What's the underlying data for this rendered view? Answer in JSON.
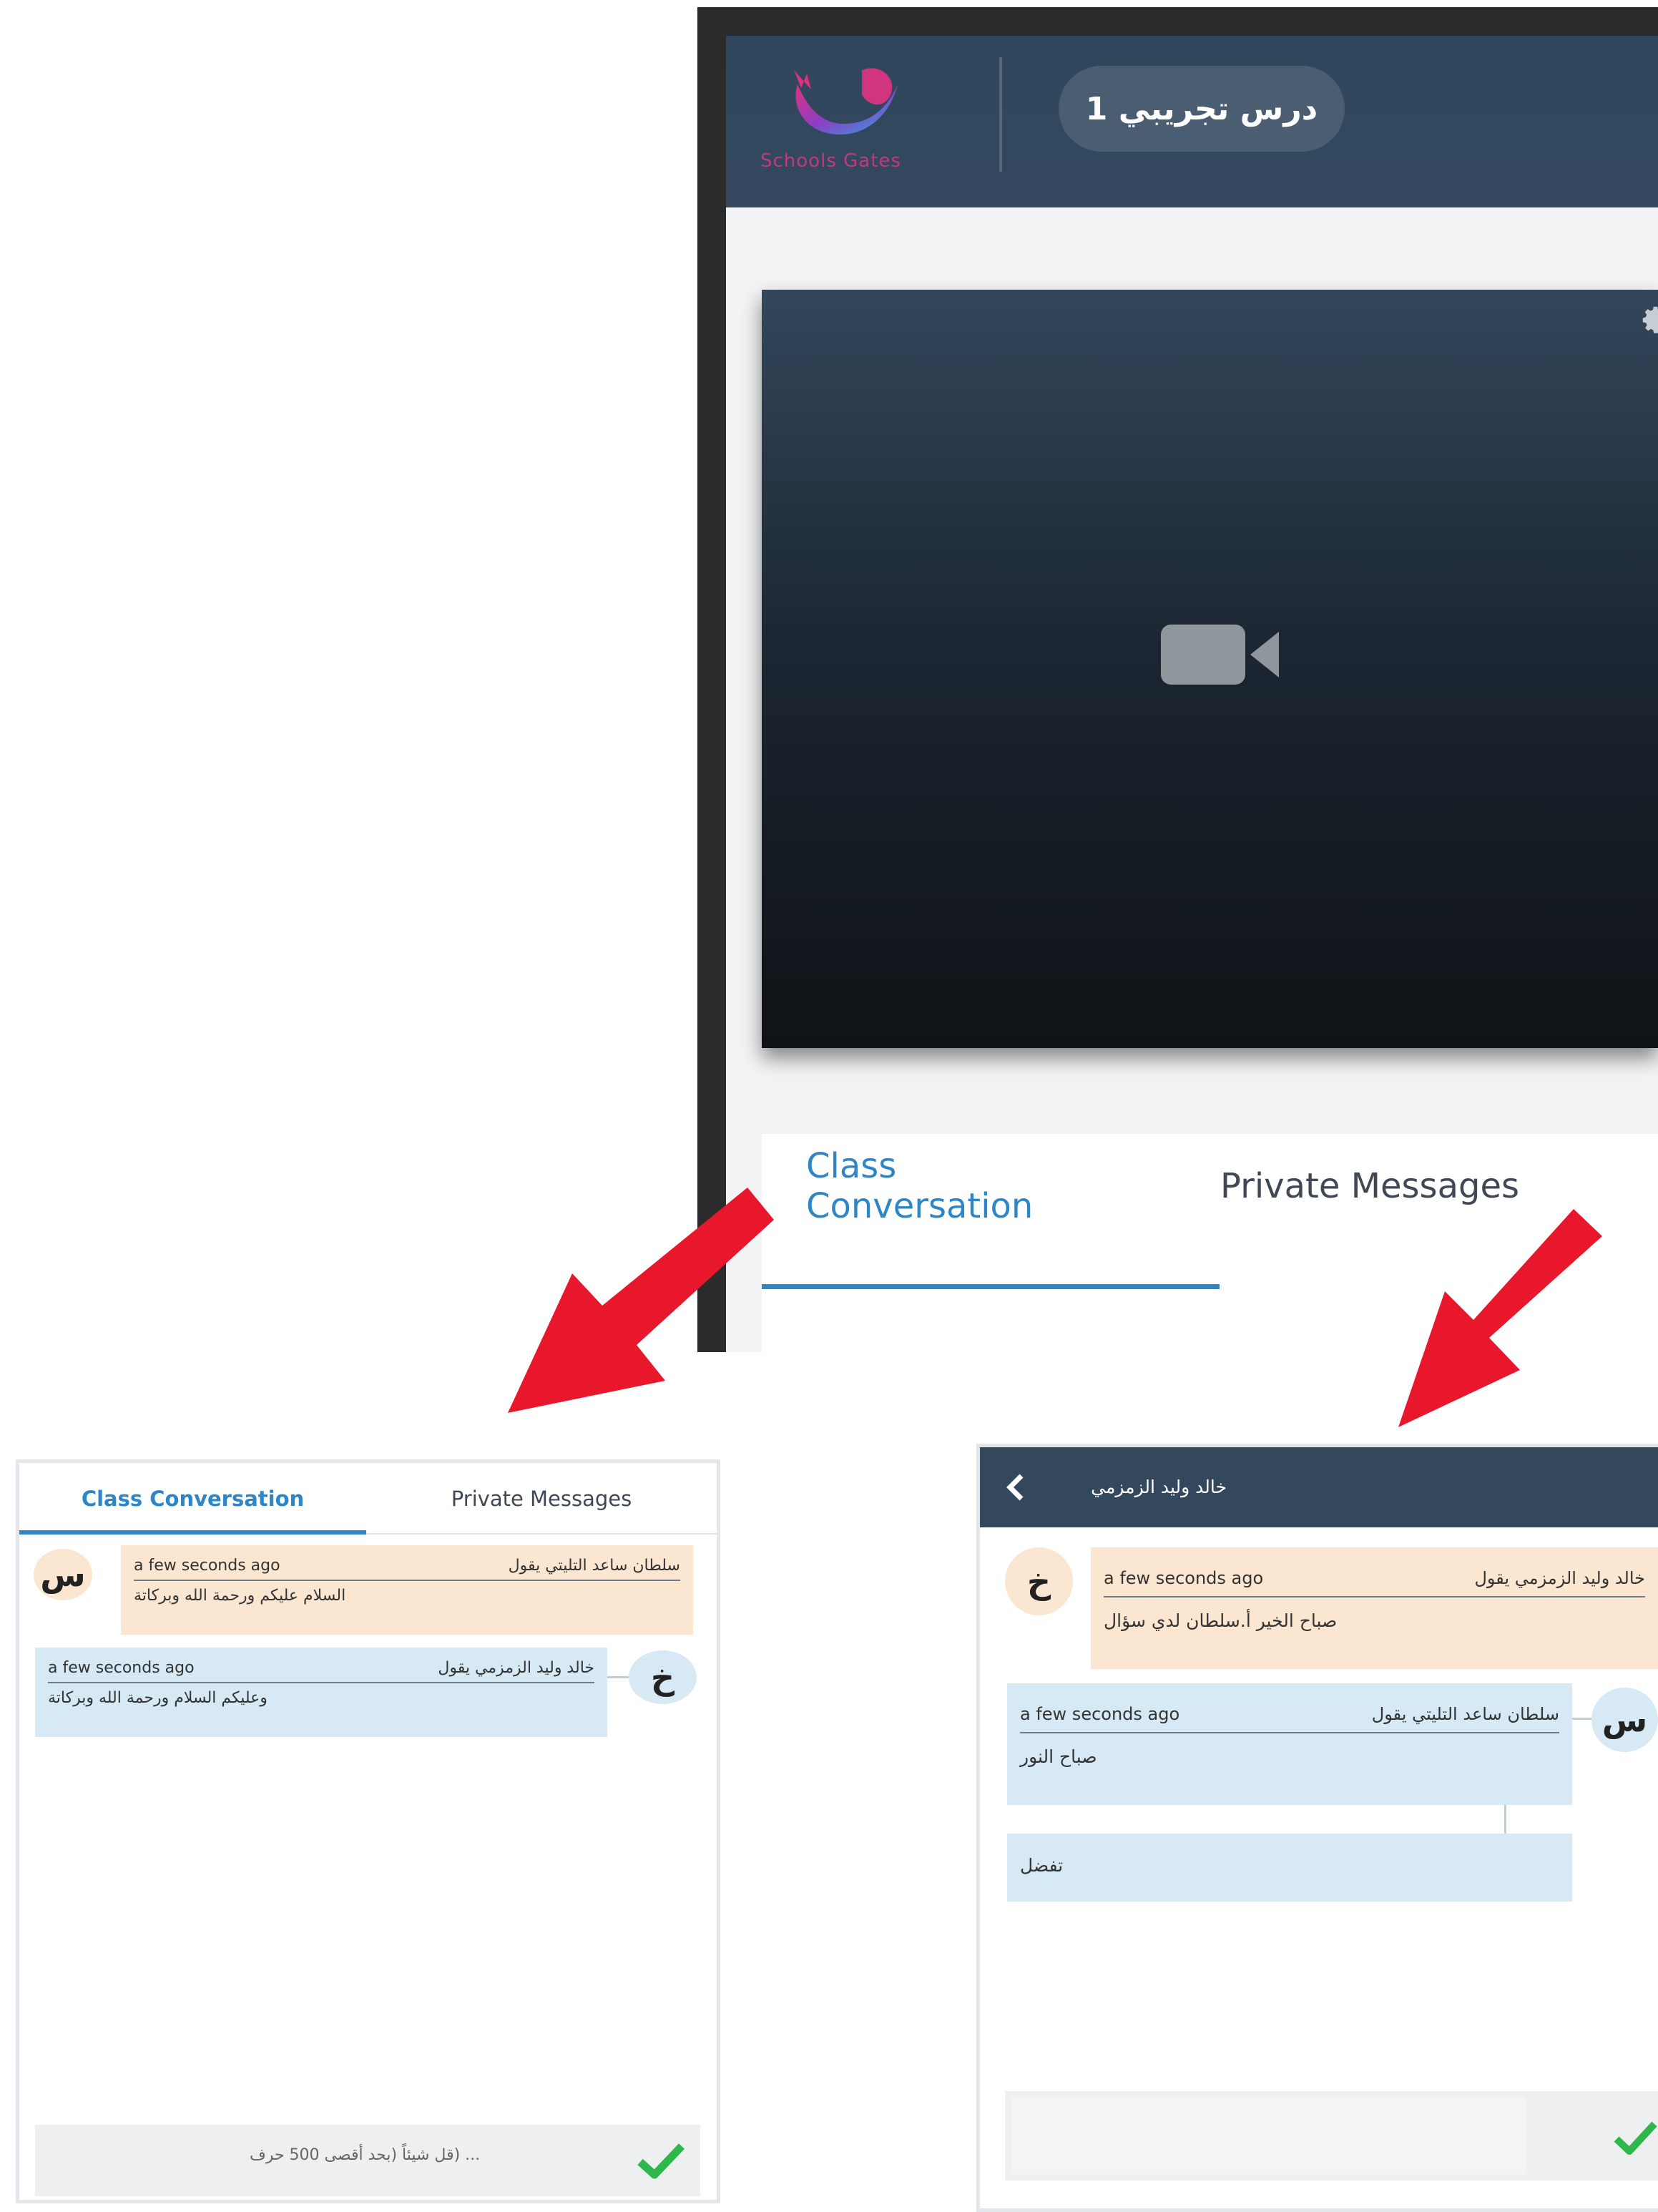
{
  "app": {
    "logo_text": "Schools Gates",
    "course_title": "درس تجريبي 1",
    "tabs": [
      {
        "label": "Class Conversation",
        "active": true
      },
      {
        "label": "Private Messages",
        "active": false
      }
    ]
  },
  "left_panel": {
    "tabs": [
      {
        "label": "Class Conversation",
        "active": true
      },
      {
        "label": "Private Messages",
        "active": false
      }
    ],
    "messages": [
      {
        "avatar": "س",
        "sender": "سلطان ساعد التليتي يقول",
        "time": "a few seconds ago",
        "text": "السلام عليكم ورحمة الله وبركاتة"
      },
      {
        "avatar": "خ",
        "sender": "خالد وليد الزمزمي يقول",
        "time": "a few seconds ago",
        "text": "وعليكم السلام ورحمة الله وبركاتة"
      }
    ],
    "input_placeholder": "... (قل شيئاً (بحد أقصى 500 حرف"
  },
  "right_panel": {
    "header_title": "خالد وليد الزمزمي",
    "messages": [
      {
        "avatar": "خ",
        "sender": "خالد وليد الزمزمي يقول",
        "time": "a few seconds ago",
        "text": "صباح الخير أ.سلطان لدي سؤال"
      },
      {
        "avatar": "س",
        "sender": "سلطان ساعد التليتي يقول",
        "time": "a few seconds ago",
        "text": "صباح النور"
      },
      {
        "text": "تفضل"
      }
    ]
  },
  "colors": {
    "accent": "#2f86c6",
    "header": "#33475d",
    "arrow": "#e8172b",
    "send_check": "#2eb84b",
    "peach_bubble": "#fbe6d2",
    "blue_bubble": "#d6e9f4"
  }
}
